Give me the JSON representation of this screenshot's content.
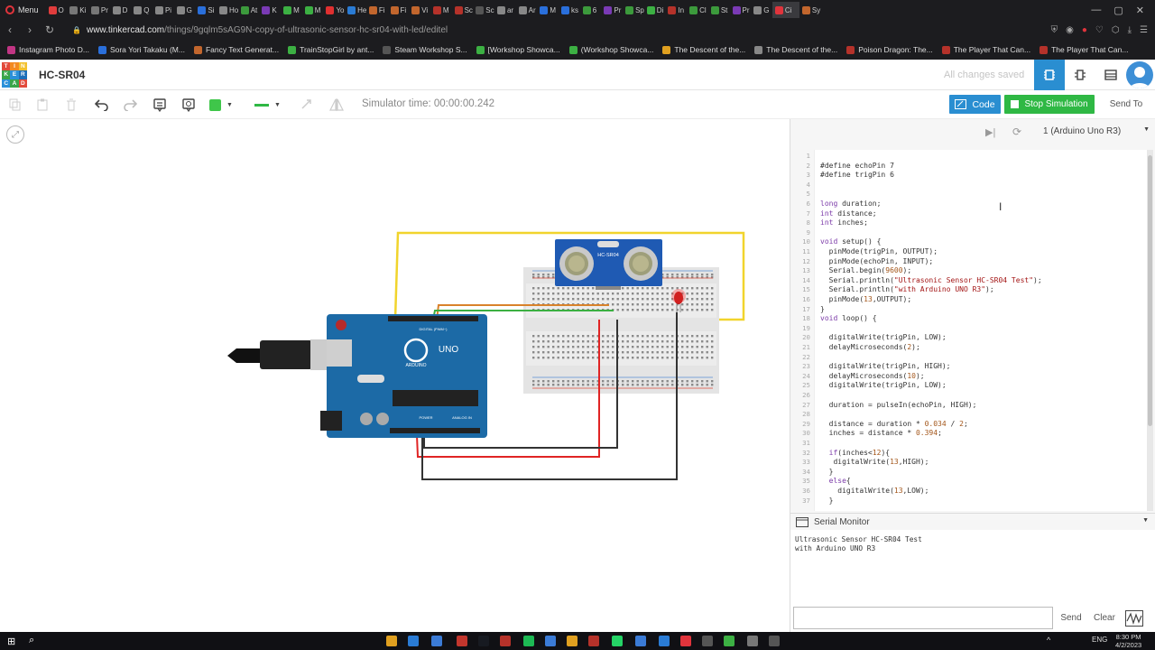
{
  "browser": {
    "menu_label": "Menu",
    "tabs": [
      {
        "label": "O",
        "color": "#e03c3c"
      },
      {
        "label": "Ki",
        "color": "#777"
      },
      {
        "label": "Pr",
        "color": "#777"
      },
      {
        "label": "D",
        "color": "#888"
      },
      {
        "label": "Q",
        "color": "#888"
      },
      {
        "label": "Pi",
        "color": "#888"
      },
      {
        "label": "G",
        "color": "#888"
      },
      {
        "label": "Si",
        "color": "#2a6fdb"
      },
      {
        "label": "Ho",
        "color": "#888"
      },
      {
        "label": "At",
        "color": "#3c9a3c"
      },
      {
        "label": "K",
        "color": "#7a3ab5"
      },
      {
        "label": "M",
        "color": "#3cb043"
      },
      {
        "label": "M",
        "color": "#3cb043"
      },
      {
        "label": "Yo",
        "color": "#e03030"
      },
      {
        "label": "He",
        "color": "#2a7bd4"
      },
      {
        "label": "Fi",
        "color": "#c2662d"
      },
      {
        "label": "Fi",
        "color": "#c2662d"
      },
      {
        "label": "Vi",
        "color": "#c2662d"
      },
      {
        "label": "M",
        "color": "#b5322a"
      },
      {
        "label": "Sc",
        "color": "#b5322a"
      },
      {
        "label": "Sc",
        "color": "#555"
      },
      {
        "label": "ar",
        "color": "#888"
      },
      {
        "label": "Ar",
        "color": "#888"
      },
      {
        "label": "M",
        "color": "#2a6fdb"
      },
      {
        "label": "ks",
        "color": "#2a6fdb"
      },
      {
        "label": "6",
        "color": "#3c9a3c"
      },
      {
        "label": "Pr",
        "color": "#7a3ab5"
      },
      {
        "label": "Sp",
        "color": "#3c9a3c"
      },
      {
        "label": "Di",
        "color": "#3cb043"
      },
      {
        "label": "In",
        "color": "#b5322a"
      },
      {
        "label": "Cl",
        "color": "#3c9a3c"
      },
      {
        "label": "St",
        "color": "#3c9a3c"
      },
      {
        "label": "Pr",
        "color": "#7a3ab5"
      },
      {
        "label": "G",
        "color": "#888"
      },
      {
        "label": "Ci",
        "color": "#e0343c"
      },
      {
        "label": "Sy",
        "color": "#c2662d"
      }
    ],
    "url_prefix": "www.tinkercad.com",
    "url_rest": "/things/9gqlm5sAG9N-copy-of-ultrasonic-sensor-hc-sr04-with-led/editel",
    "bookmarks": [
      "Instagram Photo D...",
      "Sora Yori Takaku (M...",
      "Fancy Text Generat...",
      "TrainStopGirl by ant...",
      "Steam Workshop S...",
      "[Workshop Showca...",
      "(Workshop Showca...",
      "The Descent of the...",
      "The Descent of the...",
      "Poison Dragon: The...",
      "The Player That Can...",
      "The Player That Can..."
    ]
  },
  "header": {
    "logo_letters": [
      "T",
      "I",
      "N",
      "K",
      "E",
      "R",
      "C",
      "A",
      "D"
    ],
    "logo_colors": [
      "#e24a3b",
      "#f38a21",
      "#f2c12e",
      "#3aa64a",
      "#2b90d9",
      "#1e6fb8",
      "#2b90d9",
      "#3aa64a",
      "#e24a3b"
    ],
    "project_name": "HC-SR04",
    "save_status": "All changes saved"
  },
  "toolbar": {
    "simulator_time": "Simulator time: 00:00:00.242",
    "code_label": "Code",
    "stop_label": "Stop Simulation",
    "send_to_label": "Send To",
    "board_select": "1 (Arduino Uno R3)",
    "fill_color": "#3fc64a",
    "line_color": "#2fb844"
  },
  "circuit": {
    "sensor_label": "HC-SR04",
    "arduino_label": "UNO",
    "arduino_brand": "ARDUINO",
    "digital_label": "DIGITAL (PWM~)",
    "power_label": "POWER",
    "analog_label": "ANALOG IN"
  },
  "code": {
    "lines": [
      [],
      [
        [
          "#define echoPin 7",
          ""
        ]
      ],
      [
        [
          "#define trigPin 6",
          ""
        ]
      ],
      [],
      [],
      [
        [
          "long",
          "k"
        ],
        [
          " duration;",
          ""
        ]
      ],
      [
        [
          "int",
          "k"
        ],
        [
          " distance;",
          ""
        ]
      ],
      [
        [
          "int",
          "k"
        ],
        [
          " inches;",
          ""
        ]
      ],
      [],
      [
        [
          "void",
          "k"
        ],
        [
          " setup() {",
          ""
        ]
      ],
      [
        [
          "  pinMode(trigPin, OUTPUT);",
          ""
        ]
      ],
      [
        [
          "  pinMode(echoPin, INPUT);",
          ""
        ]
      ],
      [
        [
          "  Serial.begin(",
          ""
        ],
        [
          "9600",
          "n"
        ],
        [
          ");",
          ""
        ]
      ],
      [
        [
          "  Serial.println(",
          ""
        ],
        [
          "\"Ultrasonic Sensor HC-SR04 Test\"",
          "s"
        ],
        [
          ");",
          ""
        ]
      ],
      [
        [
          "  Serial.println(",
          ""
        ],
        [
          "\"with Arduino UNO R3\"",
          "s"
        ],
        [
          ");",
          ""
        ]
      ],
      [
        [
          "  pinMode(",
          ""
        ],
        [
          "13",
          "n"
        ],
        [
          ",OUTPUT);",
          ""
        ]
      ],
      [
        [
          "}",
          ""
        ]
      ],
      [
        [
          "void",
          "k"
        ],
        [
          " loop() {",
          ""
        ]
      ],
      [],
      [
        [
          "  digitalWrite(trigPin, LOW);",
          ""
        ]
      ],
      [
        [
          "  delayMicroseconds(",
          ""
        ],
        [
          "2",
          "n"
        ],
        [
          ");",
          ""
        ]
      ],
      [],
      [
        [
          "  digitalWrite(trigPin, HIGH);",
          ""
        ]
      ],
      [
        [
          "  delayMicroseconds(",
          ""
        ],
        [
          "10",
          "n"
        ],
        [
          ");",
          ""
        ]
      ],
      [
        [
          "  digitalWrite(trigPin, LOW);",
          ""
        ]
      ],
      [],
      [
        [
          "  duration = pulseIn(echoPin, HIGH);",
          ""
        ]
      ],
      [],
      [
        [
          "  distance = duration * ",
          ""
        ],
        [
          "0.034",
          "n"
        ],
        [
          " / ",
          ""
        ],
        [
          "2",
          "n"
        ],
        [
          ";",
          ""
        ]
      ],
      [
        [
          "  inches = distance * ",
          ""
        ],
        [
          "0.394",
          "n"
        ],
        [
          ";",
          ""
        ]
      ],
      [],
      [
        [
          "  ",
          ""
        ],
        [
          "if",
          "k"
        ],
        [
          "(inches<",
          ""
        ],
        [
          "12",
          "n"
        ],
        [
          "){",
          ""
        ]
      ],
      [
        [
          "   digitalWrite(",
          ""
        ],
        [
          "13",
          "n"
        ],
        [
          ",HIGH);",
          ""
        ]
      ],
      [
        [
          "  }",
          ""
        ]
      ],
      [
        [
          "  ",
          ""
        ],
        [
          "else",
          "k"
        ],
        [
          "{",
          ""
        ]
      ],
      [
        [
          "    digitalWrite(",
          ""
        ],
        [
          "13",
          "n"
        ],
        [
          ",LOW);",
          ""
        ]
      ],
      [
        [
          "  }",
          ""
        ]
      ]
    ]
  },
  "serial": {
    "title": "Serial Monitor",
    "output": [
      "Ultrasonic Sensor HC-SR04 Test",
      "with Arduino UNO R3"
    ],
    "send_label": "Send",
    "clear_label": "Clear"
  },
  "taskbar": {
    "time": "8:30 PM",
    "date": "4/2/2023",
    "lang": "ENG"
  }
}
